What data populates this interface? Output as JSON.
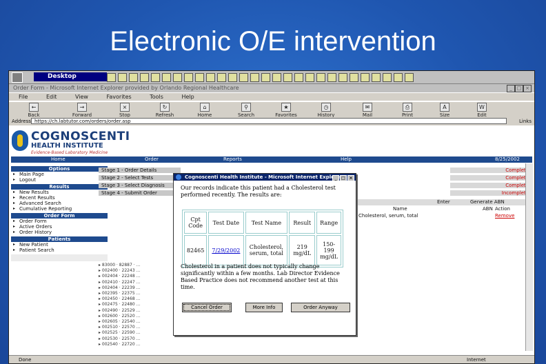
{
  "slide": {
    "title": "Electronic O/E intervention"
  },
  "os_taskbar": {
    "desktop_label": "Desktop"
  },
  "browser": {
    "window_title": "Order Form - Microsoft Internet Explorer provided by Orlando Regional Healthcare",
    "menu": [
      "File",
      "Edit",
      "View",
      "Favorites",
      "Tools",
      "Help"
    ],
    "toolbar": [
      "Back",
      "Forward",
      "Stop",
      "Refresh",
      "Home",
      "Search",
      "Favorites",
      "History",
      "Mail",
      "Print",
      "Size",
      "Edit"
    ],
    "address_label": "Address",
    "address_value": "https://ch.labtutor.com/orders/order.asp",
    "links_label": "Links"
  },
  "site": {
    "logo_line1": "COGNOSCENTI",
    "logo_line2": "HEALTH INSTITUTE",
    "logo_line3": "Evidence-Based Laboratory Medicine",
    "nav": [
      "Home",
      "Order",
      "Reports",
      "Help"
    ],
    "nav_right": "8/25/2002"
  },
  "sidebar": {
    "sections": [
      {
        "head": "Options",
        "items": [
          "Main Page",
          "Logout"
        ]
      },
      {
        "head": "Results",
        "items": [
          "New Results",
          "Recent Results",
          "Advanced Search",
          "Cumulative Reporting"
        ]
      },
      {
        "head": "Order Form",
        "items": [
          "Order Form",
          "Active Orders",
          "Order History"
        ]
      },
      {
        "head": "Patients",
        "items": [
          "New Patient",
          "Patient Search"
        ]
      }
    ]
  },
  "stages": [
    {
      "label": "Stage 1 - Order Details",
      "status": "Complete"
    },
    {
      "label": "Stage 2 - Select Tests",
      "status": "Complete"
    },
    {
      "label": "Stage 3 - Select Diagnosis",
      "status": "Complete"
    },
    {
      "label": "Stage 4 - Submit Order",
      "status": "Incomplete"
    }
  ],
  "right_panel": {
    "enter_label": "Enter",
    "generate_label": "Generate ABN",
    "name_header": "Name",
    "abn_header": "ABN",
    "action_header": "Action",
    "test_row": "Cholesterol, serum, total",
    "remove_label": "Remove"
  },
  "dialog": {
    "title": "Cognoscenti Health Institute - Microsoft Internet Explorer",
    "intro": "Our records indicate this patient had a Cholesterol test performed recently. The results are:",
    "table": {
      "headers": [
        "Cpt Code",
        "Test Date",
        "Test Name",
        "Result",
        "Range"
      ],
      "row": [
        "82465",
        "7/29/2002",
        "Cholesterol, serum, total",
        "219 mg/dL",
        "150-199 mg/dL"
      ]
    },
    "advice": "Cholesterol in a patient does not typically change significantly within a few months. Lab Director Evidence Based Practice does not recommend another test at this time.",
    "buttons": [
      "Cancel Order",
      "More Info",
      "Order Anyway"
    ]
  },
  "statusbar": {
    "left": "Done",
    "right": "Internet"
  }
}
